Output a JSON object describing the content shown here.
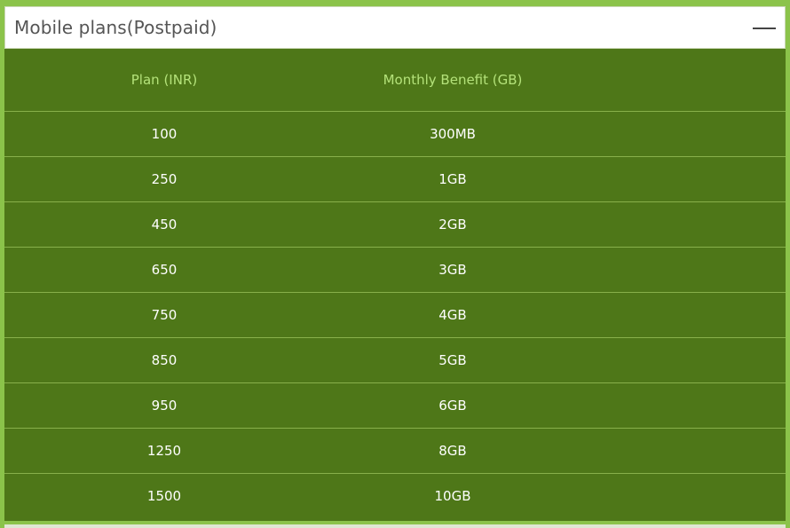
{
  "panel": {
    "title": "Mobile plans(Postpaid)",
    "collapse_icon": "minus-icon"
  },
  "table": {
    "columns": [
      "Plan (INR)",
      "Monthly Benefit (GB)"
    ],
    "rows": [
      [
        "100",
        "300MB"
      ],
      [
        "250",
        "1GB"
      ],
      [
        "450",
        "2GB"
      ],
      [
        "650",
        "3GB"
      ],
      [
        "750",
        "4GB"
      ],
      [
        "850",
        "5GB"
      ],
      [
        "950",
        "6GB"
      ],
      [
        "1250",
        "8GB"
      ],
      [
        "1500",
        "10GB"
      ]
    ]
  },
  "colors": {
    "page_bg": "#8bc34a",
    "table_bg": "#4e7718",
    "header_text": "#b4e27a",
    "cell_text": "#ffffff",
    "row_divider": "#88b04b"
  }
}
